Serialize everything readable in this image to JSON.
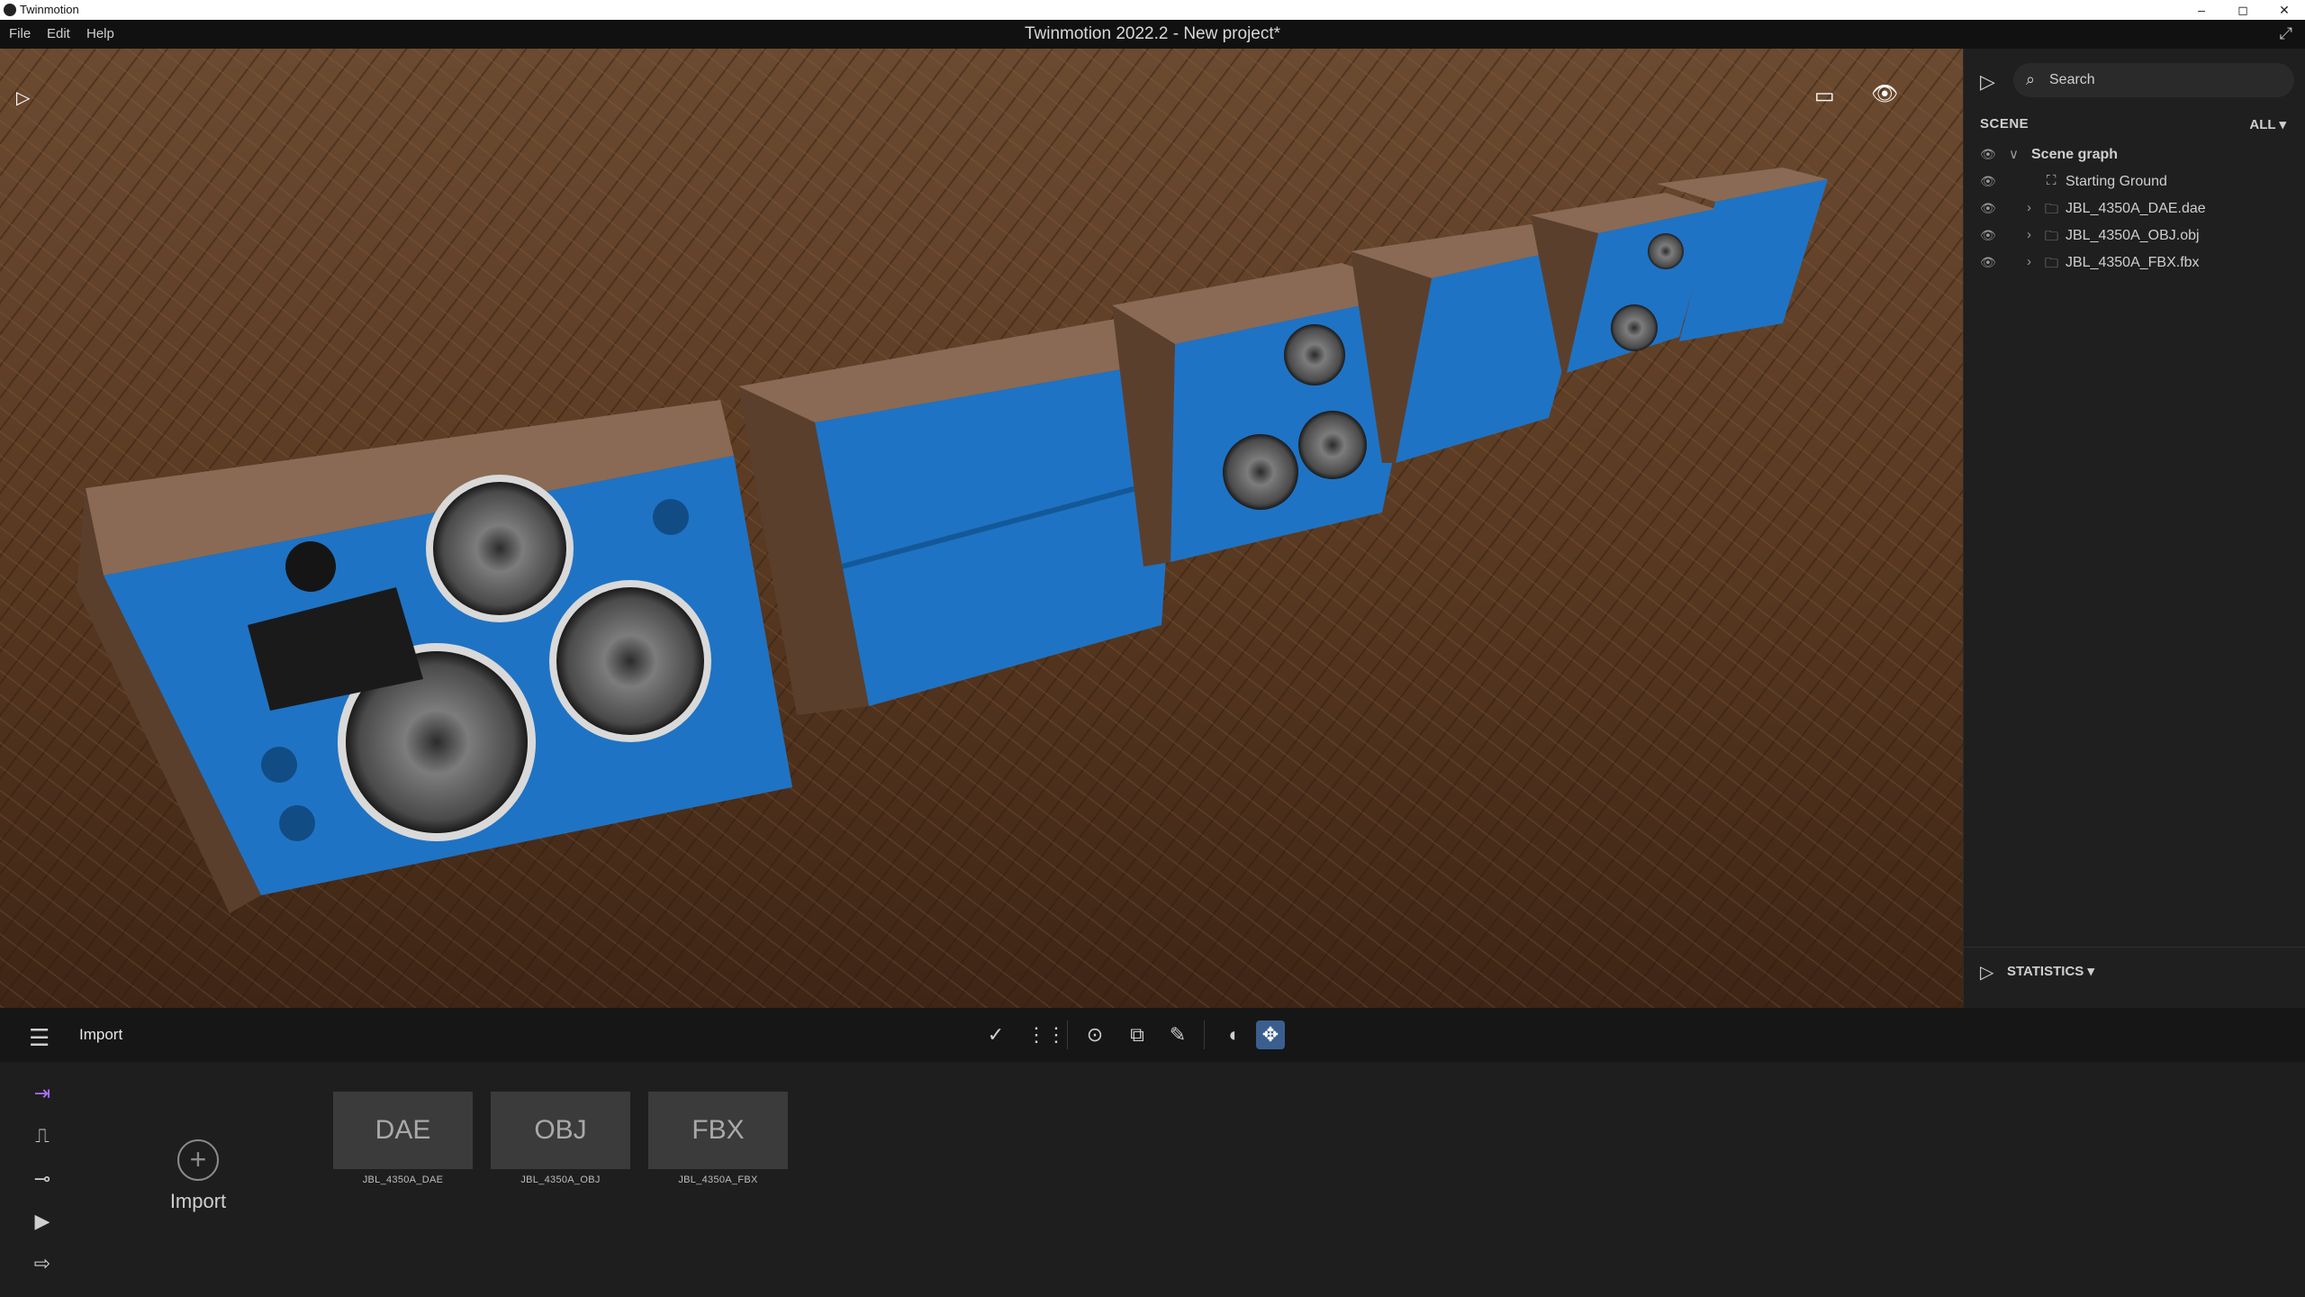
{
  "os_window": {
    "title": "Twinmotion",
    "controls": [
      "–",
      "◻",
      "✕"
    ]
  },
  "menu": {
    "items": [
      "File",
      "Edit",
      "Help"
    ],
    "window_title": "Twinmotion 2022.2 - New project*"
  },
  "viewport": {},
  "right_panel": {
    "search_placeholder": "Search",
    "scene_label": "SCENE",
    "filter_label": "ALL",
    "tree": [
      {
        "label": "Scene graph",
        "level": 0,
        "expandable": true
      },
      {
        "label": "Starting Ground",
        "level": 1,
        "expandable": false
      },
      {
        "label": "JBL_4350A_DAE.dae",
        "level": 1,
        "expandable": true
      },
      {
        "label": "JBL_4350A_OBJ.obj",
        "level": 1,
        "expandable": true
      },
      {
        "label": "JBL_4350A_FBX.fbx",
        "level": 1,
        "expandable": true
      }
    ],
    "statistics_label": "STATISTICS"
  },
  "toolbar": {
    "section_title": "Import"
  },
  "import_panel": {
    "import_button_label": "Import",
    "assets": [
      {
        "type": "DAE",
        "name": "JBL_4350A_DAE"
      },
      {
        "type": "OBJ",
        "name": "JBL_4350A_OBJ"
      },
      {
        "type": "FBX",
        "name": "JBL_4350A_FBX"
      }
    ]
  },
  "colors": {
    "accent_purple": "#a970ff",
    "active_tool": "#3a5f8f",
    "speaker_blue": "#1f73c4",
    "wood": "#8a6a55"
  }
}
